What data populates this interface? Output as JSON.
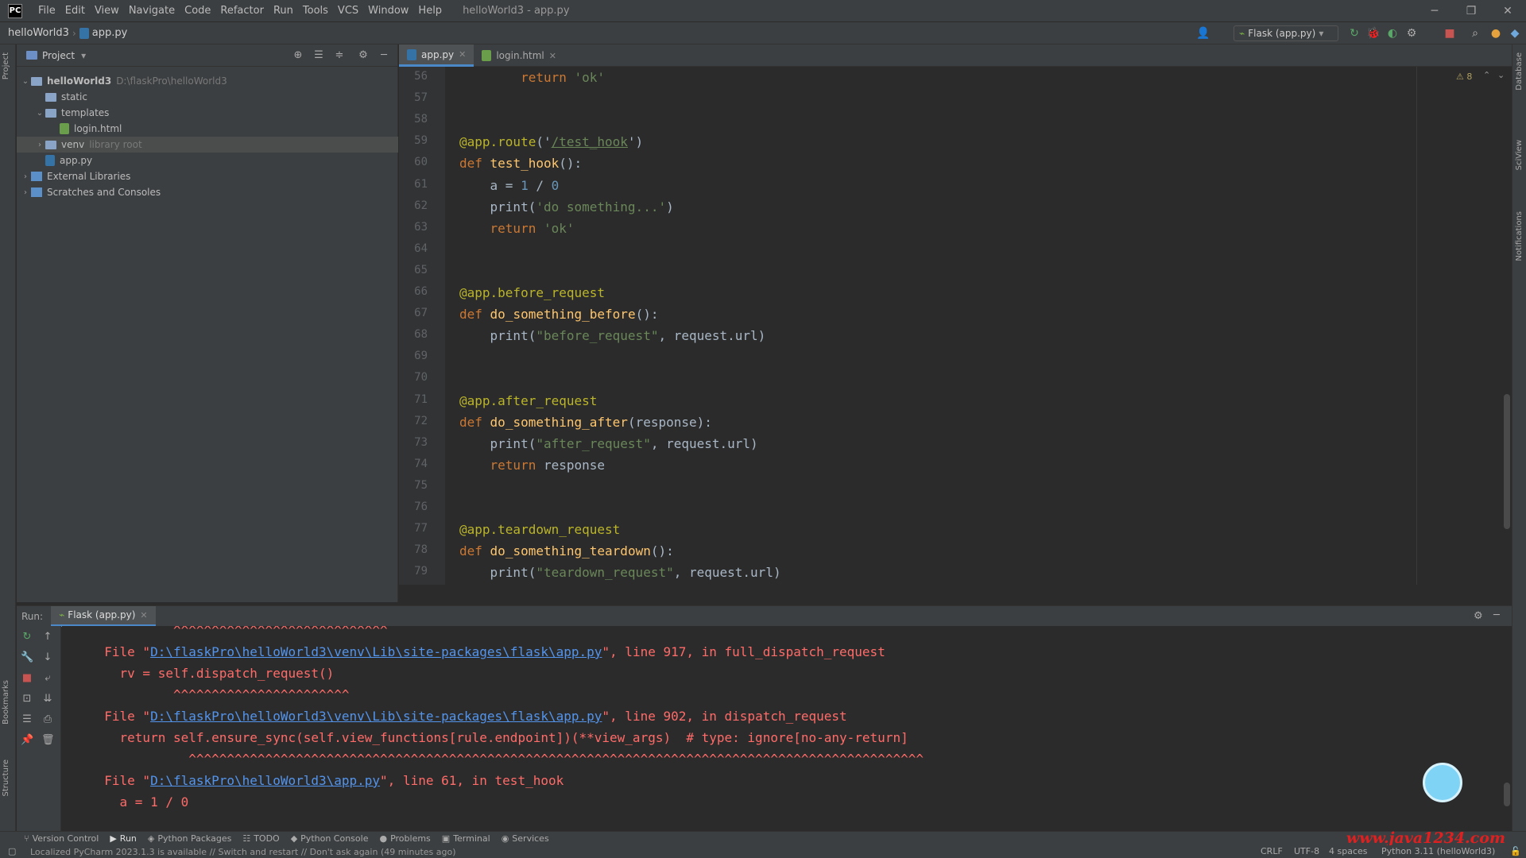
{
  "menu": {
    "logo": "PC",
    "items": [
      "File",
      "Edit",
      "View",
      "Navigate",
      "Code",
      "Refactor",
      "Run",
      "Tools",
      "VCS",
      "Window",
      "Help"
    ],
    "title": "helloWorld3 - app.py"
  },
  "nav": {
    "project": "helloWorld3",
    "file": "app.py",
    "run_config": "Flask (app.py)"
  },
  "project_panel": {
    "title": "Project",
    "tree": [
      {
        "label": "helloWorld3",
        "hint": "D:\\flaskPro\\helloWorld3",
        "indent": 0,
        "arrow": "v",
        "icon": "folder"
      },
      {
        "label": "static",
        "hint": "",
        "indent": 1,
        "arrow": "",
        "icon": "folder"
      },
      {
        "label": "templates",
        "hint": "",
        "indent": 1,
        "arrow": "v",
        "icon": "folder"
      },
      {
        "label": "login.html",
        "hint": "",
        "indent": 2,
        "arrow": "",
        "icon": "html"
      },
      {
        "label": "venv",
        "hint": "library root",
        "indent": 1,
        "arrow": ">",
        "icon": "folder",
        "selected": true
      },
      {
        "label": "app.py",
        "hint": "",
        "indent": 1,
        "arrow": "",
        "icon": "py"
      },
      {
        "label": "External Libraries",
        "hint": "",
        "indent": 0,
        "arrow": ">",
        "icon": "lib"
      },
      {
        "label": "Scratches and Consoles",
        "hint": "",
        "indent": 0,
        "arrow": ">",
        "icon": "lib"
      }
    ]
  },
  "editor": {
    "tabs": [
      {
        "label": "app.py",
        "active": true
      },
      {
        "label": "login.html",
        "active": false
      }
    ],
    "warnings": "⚠ 8",
    "lines": [
      {
        "n": "56",
        "t": "        return 'ok'"
      },
      {
        "n": "57",
        "t": ""
      },
      {
        "n": "58",
        "t": ""
      },
      {
        "n": "59",
        "t": "@app.route('/test_hook')"
      },
      {
        "n": "60",
        "t": "def test_hook():"
      },
      {
        "n": "61",
        "t": "    a = 1 / 0"
      },
      {
        "n": "62",
        "t": "    print('do something...')"
      },
      {
        "n": "63",
        "t": "    return 'ok'"
      },
      {
        "n": "64",
        "t": ""
      },
      {
        "n": "65",
        "t": ""
      },
      {
        "n": "66",
        "t": "@app.before_request"
      },
      {
        "n": "67",
        "t": "def do_something_before():"
      },
      {
        "n": "68",
        "t": "    print(\"before_request\", request.url)"
      },
      {
        "n": "69",
        "t": ""
      },
      {
        "n": "70",
        "t": ""
      },
      {
        "n": "71",
        "t": "@app.after_request"
      },
      {
        "n": "72",
        "t": "def do_something_after(response):"
      },
      {
        "n": "73",
        "t": "    print(\"after_request\", request.url)"
      },
      {
        "n": "74",
        "t": "    return response"
      },
      {
        "n": "75",
        "t": ""
      },
      {
        "n": "76",
        "t": ""
      },
      {
        "n": "77",
        "t": "@app.teardown_request"
      },
      {
        "n": "78",
        "t": "def do_something_teardown():"
      },
      {
        "n": "79",
        "t": "    print(\"teardown_request\", request.url)"
      }
    ]
  },
  "run_panel": {
    "label": "Run:",
    "tab": "Flask (app.py)",
    "console": [
      {
        "pre": "           ^^^^^^^^^^^^^^^^^^^^^^^^^^^^",
        "link": "",
        "post": ""
      },
      {
        "pre": "  File \"",
        "link": "D:\\flaskPro\\helloWorld3\\venv\\Lib\\site-packages\\flask\\app.py",
        "post": "\", line 917, in full_dispatch_request"
      },
      {
        "pre": "    rv = self.dispatch_request()",
        "link": "",
        "post": ""
      },
      {
        "pre": "           ^^^^^^^^^^^^^^^^^^^^^^^",
        "link": "",
        "post": ""
      },
      {
        "pre": "  File \"",
        "link": "D:\\flaskPro\\helloWorld3\\venv\\Lib\\site-packages\\flask\\app.py",
        "post": "\", line 902, in dispatch_request"
      },
      {
        "pre": "    return self.ensure_sync(self.view_functions[rule.endpoint])(**view_args)  # type: ignore[no-any-return]",
        "link": "",
        "post": ""
      },
      {
        "pre": "             ^^^^^^^^^^^^^^^^^^^^^^^^^^^^^^^^^^^^^^^^^^^^^^^^^^^^^^^^^^^^^^^^^^^^^^^^^^^^^^^^^^^^^^^^^^^^^^^^",
        "link": "",
        "post": ""
      },
      {
        "pre": "  File \"",
        "link": "D:\\flaskPro\\helloWorld3\\app.py",
        "post": "\", line 61, in test_hook"
      },
      {
        "pre": "    a = 1 / 0",
        "link": "",
        "post": ""
      }
    ]
  },
  "toolwindows": [
    "Version Control",
    "Run",
    "Python Packages",
    "TODO",
    "Python Console",
    "Problems",
    "Terminal",
    "Services"
  ],
  "watermark": "www.java1234.com",
  "status": {
    "message": "Localized PyCharm 2023.1.3 is available // Switch and restart // Don't ask again (49 minutes ago)",
    "crlf": "CRLF",
    "encoding": "UTF-8",
    "indent": "4 spaces",
    "interpreter": "Python 3.11 (helloWorld3)"
  },
  "colors": {
    "accent": "#4a88c7",
    "error": "#ff6b68",
    "link": "#5394ec"
  }
}
